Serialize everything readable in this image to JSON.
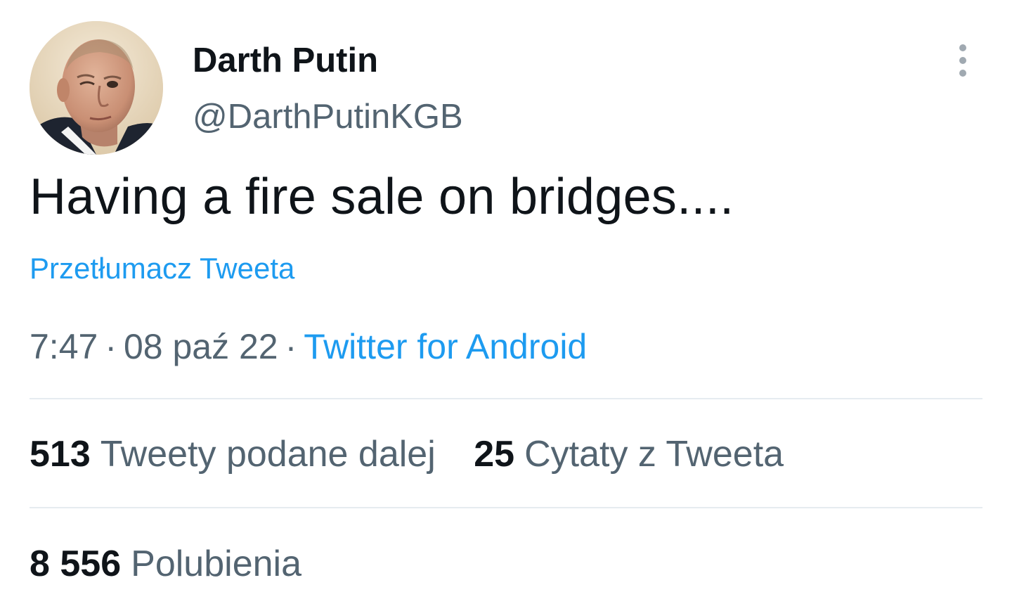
{
  "author": {
    "display_name": "Darth Putin",
    "handle": "@DarthPutinKGB"
  },
  "tweet": {
    "text": "Having a fire sale on bridges....",
    "translate_label": "Przetłumacz Tweeta",
    "time": "7:47",
    "date": "08 paź 22",
    "separator": "·",
    "source": "Twitter for Android"
  },
  "stats": {
    "retweets_count": "513",
    "retweets_label": "Tweety podane dalej",
    "quotes_count": "25",
    "quotes_label": "Cytaty z Tweeta",
    "likes_count": "8 556",
    "likes_label": "Polubienia"
  },
  "icons": {
    "avatar": "avatar-photo",
    "more": "more-options-icon"
  },
  "colors": {
    "text_primary": "#0f1419",
    "text_secondary": "#536471",
    "link": "#1d9bf0",
    "divider": "#e6ecf0"
  }
}
